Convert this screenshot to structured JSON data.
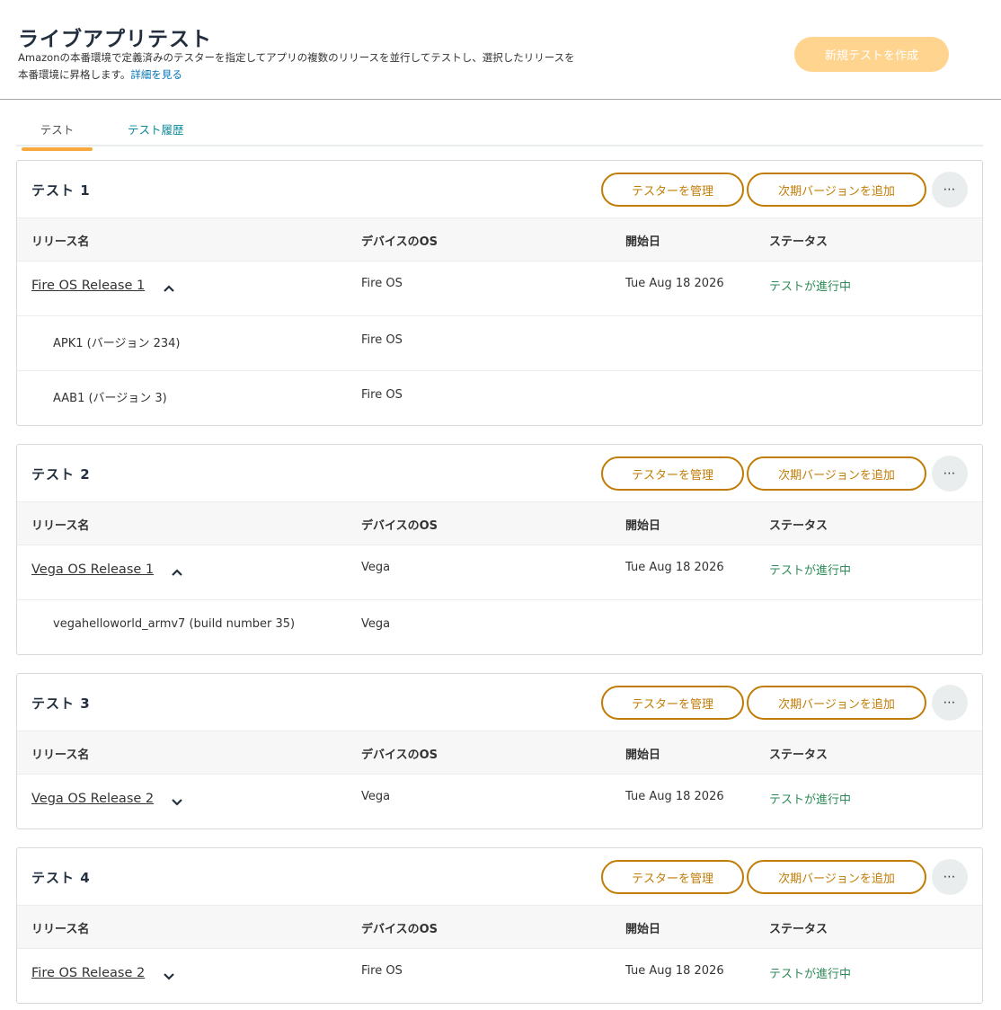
{
  "header": {
    "title": "ライブアプリテスト",
    "description": "Amazonの本番環境で定義済みのテスターを指定してアプリの複数のリリースを並行してテストし、選択したリリースを本番環境に昇格します。",
    "learn_more": "詳細を見る",
    "create_button": "新規テストを作成"
  },
  "tabs": [
    {
      "label": "テスト",
      "active": true
    },
    {
      "label": "テスト履歴",
      "active": false
    }
  ],
  "buttons": {
    "manage_testers": "テスターを管理",
    "add_next_version": "次期バージョンを追加",
    "more": "⋯"
  },
  "columns": [
    "リリース名",
    "デバイスのOS",
    "開始日",
    "ステータス"
  ],
  "tests": [
    {
      "title": "テスト 1",
      "release": {
        "name": "Fire OS Release 1",
        "expanded": true,
        "os": "Fire OS",
        "start": "Tue Aug 18 2026",
        "status": "テストが進行中"
      },
      "builds": [
        {
          "name": "APK1 (バージョン 234)",
          "os": "Fire OS"
        },
        {
          "name": "AAB1 (バージョン 3)",
          "os": "Fire OS"
        }
      ]
    },
    {
      "title": "テスト 2",
      "release": {
        "name": "Vega OS Release 1",
        "expanded": true,
        "os": "Vega",
        "start": "Tue Aug 18 2026",
        "status": "テストが進行中"
      },
      "builds": [
        {
          "name": "vegahelloworld_armv7 (build number 35)",
          "os": "Vega"
        }
      ]
    },
    {
      "title": "テスト 3",
      "release": {
        "name": "Vega OS Release 2",
        "expanded": false,
        "os": "Vega",
        "start": "Tue Aug 18 2026",
        "status": "テストが進行中"
      },
      "builds": []
    },
    {
      "title": "テスト 4",
      "release": {
        "name": "Fire OS Release 2",
        "expanded": false,
        "os": "Fire OS",
        "start": "Tue Aug 18 2026",
        "status": "テストが進行中"
      },
      "builds": []
    }
  ],
  "colors": {
    "accent": "#f7a93e",
    "button_outline": "#c17c06",
    "status_green": "#2e8b57",
    "link_teal": "#0b8b9a"
  }
}
